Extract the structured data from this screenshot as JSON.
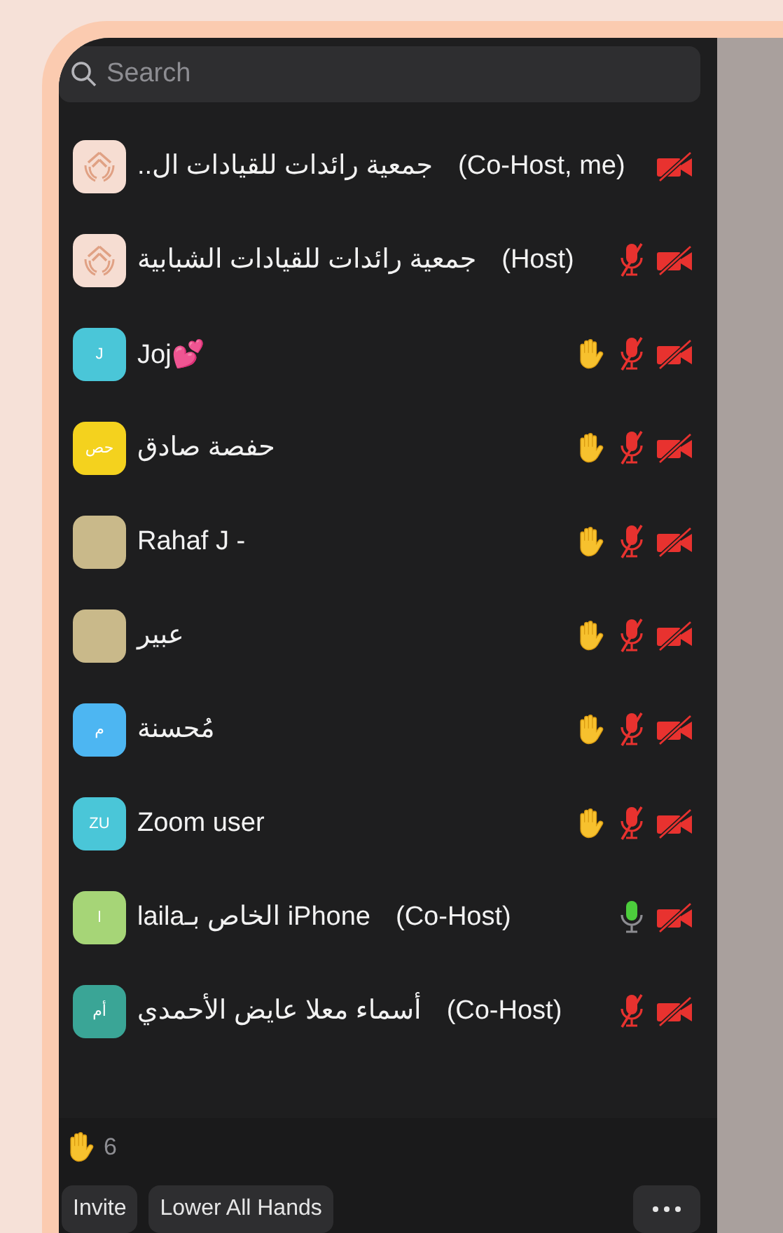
{
  "search": {
    "placeholder": "Search"
  },
  "participants": [
    {
      "name": "جمعية رائدات للقيادات ال..",
      "role": "(Co-Host, me)",
      "avatar": {
        "kind": "logo"
      },
      "hand_raised": false,
      "video_off": true
    },
    {
      "name": "جمعية رائدات للقيادات الشبابية",
      "role": "(Host)",
      "avatar": {
        "kind": "logo"
      },
      "hand_raised": false,
      "mic_muted": true,
      "video_off": true
    },
    {
      "name": "Joj💕",
      "avatar": {
        "kind": "initials",
        "initials": "J",
        "color": "#4ac6d8"
      },
      "hand_raised": true,
      "mic_muted": true,
      "video_off": true
    },
    {
      "name": "حفصة صادق",
      "avatar": {
        "kind": "initials",
        "initials": "حص",
        "color": "#f4d21e"
      },
      "hand_raised": true,
      "mic_muted": true,
      "video_off": true
    },
    {
      "name": "Rahaf J -",
      "avatar": {
        "kind": "photo"
      },
      "hand_raised": true,
      "mic_muted": true,
      "video_off": true
    },
    {
      "name": "عبير",
      "avatar": {
        "kind": "photo"
      },
      "hand_raised": true,
      "mic_muted": true,
      "video_off": true
    },
    {
      "name": "مُحسنة",
      "avatar": {
        "kind": "initials",
        "initials": "م",
        "color": "#4db6f2"
      },
      "hand_raised": true,
      "mic_muted": true,
      "video_off": true
    },
    {
      "name": "Zoom user",
      "avatar": {
        "kind": "initials",
        "initials": "ZU",
        "color": "#4ac6d8"
      },
      "hand_raised": true,
      "mic_muted": true,
      "video_off": true
    },
    {
      "name": "iPhone الخاص بـlaila",
      "role": "(Co-Host)",
      "avatar": {
        "kind": "initials",
        "initials": "l",
        "color": "#a6d577"
      },
      "hand_raised": false,
      "mic_muted": false,
      "video_off": true
    },
    {
      "name": "أسماء معلا عايض الأحمدي",
      "role": "(Co-Host)",
      "avatar": {
        "kind": "initials",
        "initials": "أم",
        "color": "#3aa596"
      },
      "hand_raised": false,
      "mic_muted": true,
      "video_off": true
    }
  ],
  "raised_hands": {
    "count": "6"
  },
  "invite_button": "Invite",
  "lower_hands_button": "Lower All Hands"
}
